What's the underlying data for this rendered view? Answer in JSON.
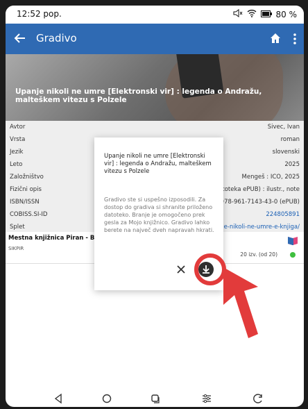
{
  "status_bar": {
    "time": "12:52 pop.",
    "battery": "80 %"
  },
  "app_bar": {
    "title": "Gradivo",
    "back_icon": "arrow-left",
    "home_icon": "home",
    "menu_icon": "more-vert",
    "color": "#2f6ab3"
  },
  "banner": {
    "title": "Upanje nikoli ne umre [Elektronski vir] : legenda o Andražu, malteškem vitezu s Polzele"
  },
  "details": [
    {
      "label": "Avtor",
      "value": "Sivec, Ivan"
    },
    {
      "label": "Vrsta",
      "value": "roman"
    },
    {
      "label": "Jezik",
      "value": "slovenski"
    },
    {
      "label": "Leto",
      "value": "2025"
    },
    {
      "label": "Založništvo",
      "value": "Mengeš : ICO, 2025"
    },
    {
      "label": "Fizični opis",
      "value": "datoteka ePUB) : ilustr., note"
    },
    {
      "label": "ISBN/ISSN",
      "value": "978-961-7143-43-0 (ePUB)"
    },
    {
      "label": "COBISS.SI-ID",
      "value": "224805891"
    },
    {
      "label": "Splet",
      "value": "nje-nikoli-ne-umre-e-knjiga/"
    }
  ],
  "library": {
    "name": "Mestna knjižnica Piran - Biblio",
    "code": "SIKPIR",
    "availability": "20 izv. (od 20)",
    "status_color": "#3fbf3f"
  },
  "dialog": {
    "title": "Upanje nikoli ne umre [Elektronski vir] : legenda o Andražu, malteškem vitezu s Polzele",
    "body": "Gradivo ste si uspešno izposodili. Za dostop do gradiva si shranite priloženo datoteko. Branje je omogočeno prek gesla za Mojo knjižnico. Gradivo lahko berete na največ dveh napravah hkrati.",
    "close_icon": "close",
    "download_icon": "download"
  },
  "annotation": {
    "color": "#e23b3b"
  },
  "nav_bar": {
    "icons": [
      "back-triangle",
      "home-circle",
      "recents-square",
      "settings-sliders",
      "rotate"
    ]
  }
}
